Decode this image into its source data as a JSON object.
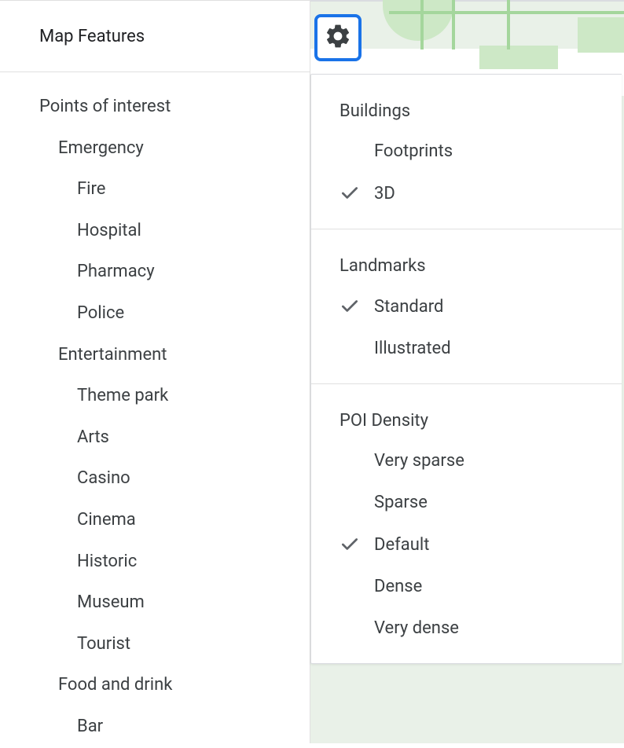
{
  "sidebar": {
    "title": "Map Features",
    "tree": [
      {
        "label": "Points of interest",
        "indent": 0
      },
      {
        "label": "Emergency",
        "indent": 1
      },
      {
        "label": "Fire",
        "indent": 2
      },
      {
        "label": "Hospital",
        "indent": 2
      },
      {
        "label": "Pharmacy",
        "indent": 2
      },
      {
        "label": "Police",
        "indent": 2
      },
      {
        "label": "Entertainment",
        "indent": 1
      },
      {
        "label": "Theme park",
        "indent": 2
      },
      {
        "label": "Arts",
        "indent": 2
      },
      {
        "label": "Casino",
        "indent": 2
      },
      {
        "label": "Cinema",
        "indent": 2
      },
      {
        "label": "Historic",
        "indent": 2
      },
      {
        "label": "Museum",
        "indent": 2
      },
      {
        "label": "Tourist",
        "indent": 2
      },
      {
        "label": "Food and drink",
        "indent": 1
      },
      {
        "label": "Bar",
        "indent": 2
      }
    ]
  },
  "settings": {
    "sections": [
      {
        "title": "Buildings",
        "options": [
          {
            "label": "Footprints",
            "checked": false
          },
          {
            "label": "3D",
            "checked": true
          }
        ]
      },
      {
        "title": "Landmarks",
        "options": [
          {
            "label": "Standard",
            "checked": true
          },
          {
            "label": "Illustrated",
            "checked": false
          }
        ]
      },
      {
        "title": "POI Density",
        "options": [
          {
            "label": "Very sparse",
            "checked": false
          },
          {
            "label": "Sparse",
            "checked": false
          },
          {
            "label": "Default",
            "checked": true
          },
          {
            "label": "Dense",
            "checked": false
          },
          {
            "label": "Very dense",
            "checked": false
          }
        ]
      }
    ]
  }
}
